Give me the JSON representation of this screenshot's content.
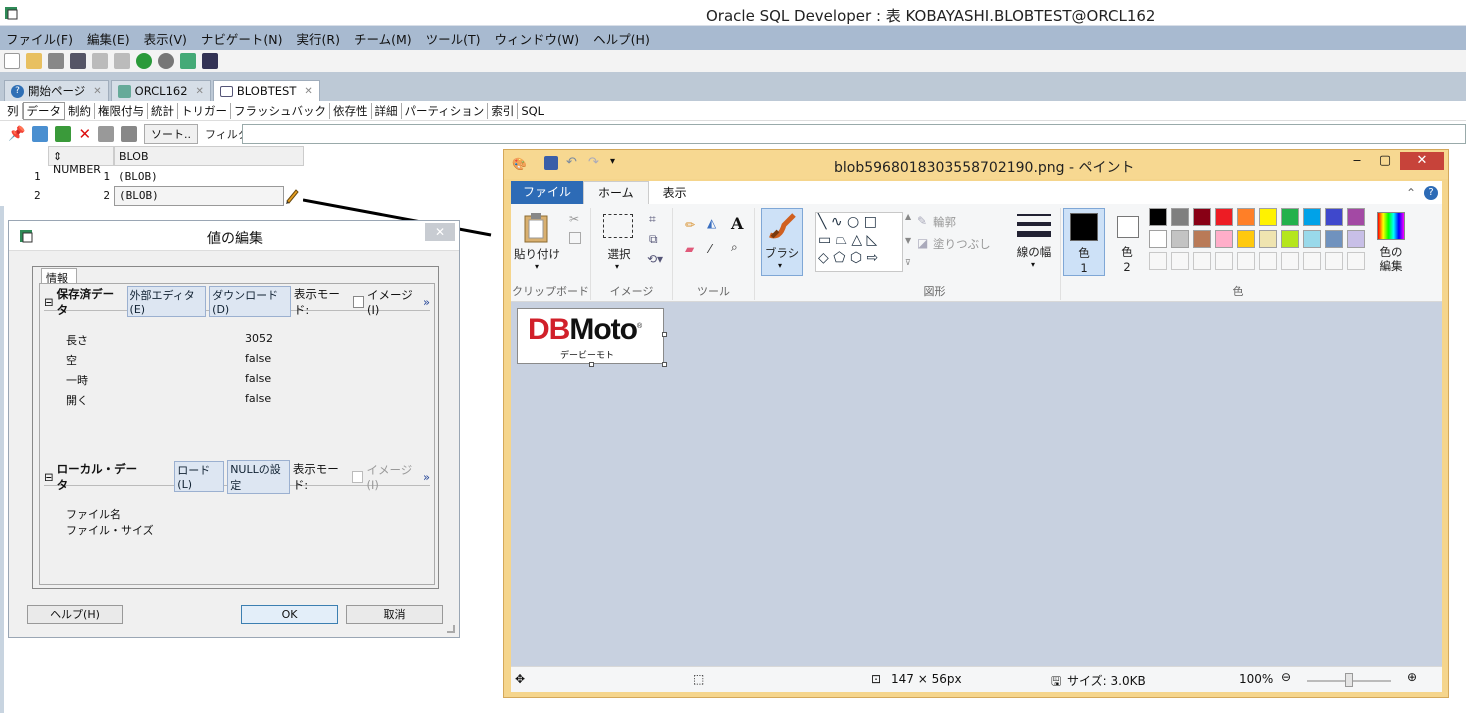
{
  "window": {
    "title": "Oracle SQL Developer : 表 KOBAYASHI.BLOBTEST@ORCL162"
  },
  "menu": [
    "ファイル(F)",
    "編集(E)",
    "表示(V)",
    "ナビゲート(N)",
    "実行(R)",
    "チーム(M)",
    "ツール(T)",
    "ウィンドウ(W)",
    "ヘルプ(H)"
  ],
  "tabs": [
    {
      "label": "開始ページ"
    },
    {
      "label": "ORCL162"
    },
    {
      "label": "BLOBTEST"
    }
  ],
  "subtabs": [
    "列",
    "データ",
    "制約",
    "権限付与",
    "統計",
    "トリガー",
    "フラッシュバック",
    "依存性",
    "詳細",
    "パーティション",
    "索引",
    "SQL"
  ],
  "data_toolbar": {
    "sort": "ソート..",
    "filter_label": "フィルタ:",
    "filter_value": ""
  },
  "grid": {
    "columns": [
      "NUMBER",
      "BLOB"
    ],
    "rows": [
      {
        "row": "1",
        "number": "1",
        "blob": "(BLOB)"
      },
      {
        "row": "2",
        "number": "2",
        "blob": "(BLOB)"
      }
    ]
  },
  "dialog": {
    "title": "値の編集",
    "info_tab": "情報",
    "saved": {
      "header": "保存済データ",
      "ext_editor": "外部エディタ(E)",
      "download": "ダウンロード(D)",
      "display_mode": "表示モード:",
      "image": "イメージ(I)",
      "fields": [
        {
          "k": "長さ",
          "v": "3052"
        },
        {
          "k": "空",
          "v": "false"
        },
        {
          "k": "一時",
          "v": "false"
        },
        {
          "k": "開く",
          "v": "false"
        }
      ]
    },
    "local": {
      "header": "ローカル・データ",
      "load": "ロード(L)",
      "set_null": "NULLの設定",
      "display_mode": "表示モード:",
      "image": "イメージ(I)",
      "fields": [
        "ファイル名",
        "ファイル・サイズ"
      ]
    },
    "buttons": {
      "help": "ヘルプ(H)",
      "ok": "OK",
      "cancel": "取消"
    }
  },
  "paint": {
    "title": "blob5968018303558702190.png - ペイント",
    "menu": {
      "file": "ファイル",
      "home": "ホーム",
      "view": "表示"
    },
    "ribbon": {
      "paste": "貼り付け",
      "clipboard": "クリップボード",
      "select": "選択",
      "image": "イメージ",
      "tools": "ツール",
      "brush": "ブラシ",
      "outline": "輪郭",
      "fill": "塗りつぶし",
      "shapes": "図形",
      "line_width": "線の幅",
      "color1": "色",
      "color1_num": "1",
      "color2": "色",
      "color2_num": "2",
      "edit_colors_1": "色の",
      "edit_colors_2": "編集",
      "colors": "色"
    },
    "palette_row1": [
      "#000000",
      "#7f7f7f",
      "#880015",
      "#ed1c24",
      "#ff7f27",
      "#fff200",
      "#22b14c",
      "#00a2e8",
      "#3f48cc",
      "#a349a4"
    ],
    "palette_row2": [
      "#ffffff",
      "#c3c3c3",
      "#b97a57",
      "#ffaec9",
      "#ffc90e",
      "#efe4b0",
      "#b5e61d",
      "#99d9ea",
      "#7092be",
      "#c8bfe7"
    ],
    "image": {
      "logo_db": "DB",
      "logo_moto": "Moto",
      "reg": "®",
      "subtitle": "デービーモト"
    },
    "status": {
      "dimensions": "147 × 56px",
      "size": "サイズ: 3.0KB",
      "zoom": "100%"
    }
  }
}
